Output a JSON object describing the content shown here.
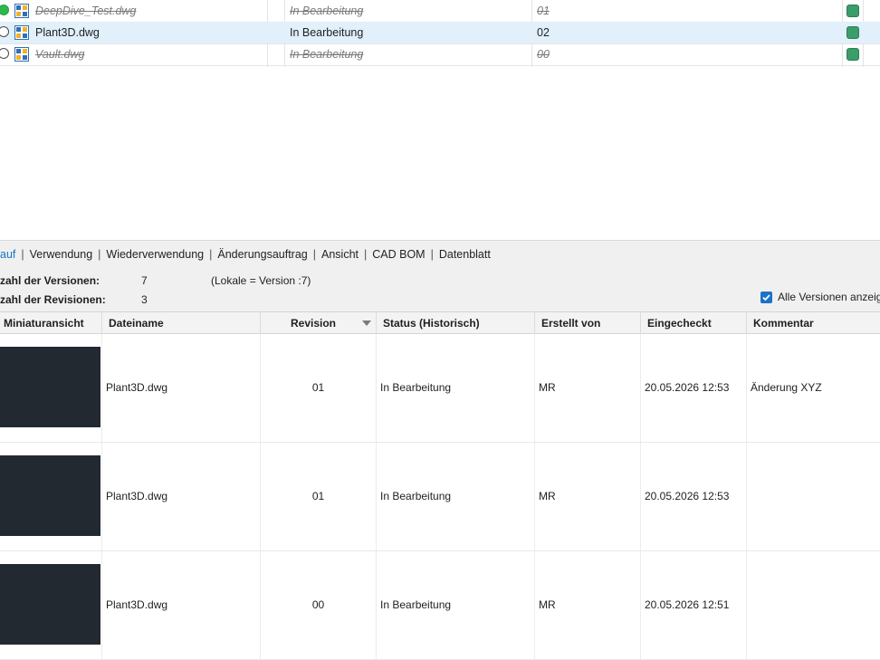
{
  "files": [
    {
      "status_icon": "circle-filled-green",
      "name": "DeepDive_Test.dwg",
      "state": "In Bearbeitung",
      "revision": "01",
      "struck": true,
      "selected": false,
      "state_color": "#3a9d6a"
    },
    {
      "status_icon": "circle-empty",
      "name": "Plant3D.dwg",
      "state": "In Bearbeitung",
      "revision": "02",
      "struck": false,
      "selected": true,
      "state_color": "#3a9d6a"
    },
    {
      "status_icon": "circle-empty",
      "name": "Vault.dwg",
      "state": "In Bearbeitung",
      "revision": "00",
      "struck": true,
      "selected": false,
      "state_color": "#3a9d6a"
    }
  ],
  "tabs": [
    {
      "label": "auf",
      "active": true
    },
    {
      "label": "Verwendung",
      "active": false
    },
    {
      "label": "Wiederverwendung",
      "active": false
    },
    {
      "label": "Änderungsauftrag",
      "active": false
    },
    {
      "label": "Ansicht",
      "active": false
    },
    {
      "label": "CAD BOM",
      "active": false
    },
    {
      "label": "Datenblatt",
      "active": false
    }
  ],
  "tab_separator": "|",
  "info": {
    "versions_label": "zahl der Versionen:",
    "versions_value": "7",
    "versions_note": "(Lokale = Version :7)",
    "revisions_label": "zahl der Revisionen:",
    "revisions_value": "3"
  },
  "show_all_versions": {
    "label": "Alle Versionen anzeig",
    "checked": true
  },
  "grid": {
    "columns": [
      "Miniaturansicht",
      "Dateiname",
      "Revision",
      "Status (Historisch)",
      "Erstellt von",
      "Eingecheckt",
      "Kommentar"
    ],
    "rows": [
      {
        "filename": "Plant3D.dwg",
        "revision": "01",
        "status": "In Bearbeitung",
        "created_by": "MR",
        "checked_in": "20.05.2026 12:53",
        "comment": "Änderung XYZ"
      },
      {
        "filename": "Plant3D.dwg",
        "revision": "01",
        "status": "In Bearbeitung",
        "created_by": "MR",
        "checked_in": "20.05.2026 12:53",
        "comment": ""
      },
      {
        "filename": "Plant3D.dwg",
        "revision": "00",
        "status": "In Bearbeitung",
        "created_by": "MR",
        "checked_in": "20.05.2026 12:51",
        "comment": ""
      }
    ]
  },
  "colors": {
    "accent": "#1a73c9",
    "selected_row": "#e1f0fa",
    "state_green": "#3a9d6a",
    "thumb_bg": "#232931"
  }
}
